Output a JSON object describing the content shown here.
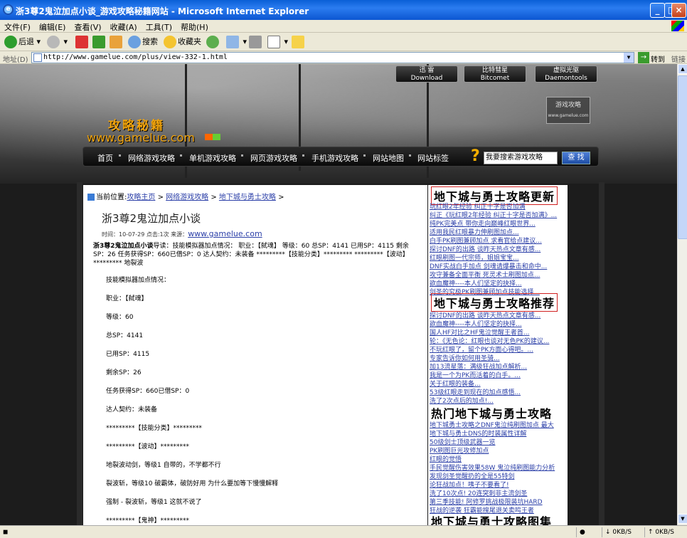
{
  "window": {
    "title": "浙3尊2鬼泣加点小谈_游戏攻略秘籍网站 - Microsoft Internet Explorer",
    "controls": {
      "minimize": "_",
      "maximize": "□",
      "close": "×"
    },
    "app_icon": "e"
  },
  "menu": [
    "文件(F)",
    "编辑(E)",
    "查看(V)",
    "收藏(A)",
    "工具(T)",
    "帮助(H)"
  ],
  "toolbar": {
    "back": "后退",
    "search": "搜索",
    "favorites": "收藏夹"
  },
  "address": {
    "label": "地址(D)",
    "url": "http://www.gamelue.com/plus/view-332-1.html",
    "dropdown": "▼",
    "go_arrow": "→",
    "go": "转到",
    "links": "链接"
  },
  "site": {
    "top_buttons": [
      {
        "label": "迅 雷",
        "sub": "Download"
      },
      {
        "label": "比特彗星",
        "sub": "Bitcomet"
      },
      {
        "label": "虚拟光驱",
        "sub": "Daemontools"
      }
    ],
    "stamp": {
      "line1": "游戏攻略",
      "line2": "www.gamelue.com"
    },
    "logo_text": "攻略秘籍",
    "logo_url": "www.gamelue.com",
    "nav": [
      "首页",
      "网络游戏攻略",
      "单机游戏攻略",
      "网页游戏攻略",
      "手机游戏攻略",
      "网站地图",
      "网站标签"
    ],
    "search_icon": "?",
    "search_placeholder": "我要搜索游戏攻略",
    "search_button": "查 找"
  },
  "article": {
    "breadcrumb_label": "当前位置:",
    "breadcrumb": [
      "攻略主页",
      "网络游戏攻略",
      "地下城与勇士攻略"
    ],
    "breadcrumb_sep": ">",
    "title": "浙3尊2鬼泣加点小谈",
    "meta_time": "时间：10-07-29 点击:1次 来源：",
    "meta_source": "www.gamelue.com",
    "summary_bold": "浙3尊2鬼泣加点小谈",
    "summary_text": "导读：技能模拟器加点情况： 职业：【弑魂】 等级：60 总SP：4141 已用SP：4115 剩余SP：26 任务获得SP：660已借SP：0 达人契约：未装备 *********【技能分类】********* *********【波动】********* 地裂波",
    "paragraphs": [
      "技能模拟器加点情况：",
      "职业：【弑魂】",
      "等级：60",
      "总SP：4141",
      "已用SP：4115",
      "剩余SP：26",
      "任务获得SP：660已借SP：0",
      "达人契约：未装备",
      "*********【技能分类】*********",
      "*********【波动】*********",
      "地裂波动剑，等级1 自带的，不学都不行",
      "裂波斩，等级10 破霸体，破防好用 为什么要加等下慢慢解释",
      "强制 - 裂波斩，等级1 这就不说了",
      "*********【鬼神】*********"
    ]
  },
  "sidebar": {
    "sections": [
      {
        "heading": "地下城与勇士攻略更新",
        "links": [
          "玩红眼2年经验 纠正十字是否加满",
          "纠正《玩红眼2年经验 纠正十字是否加满》...",
          "纯PK完美点 带你走向巅峰红眼世界...",
          "适用我民红眼暴力伸刷图加点...",
          "白手PK刷图兼顾加点 求看官给点建议...",
          "探讨DNF的出路 谈昨天热点文章有感...",
          "红眼刷图一代宗师，姐姐宝宝...",
          "DNF实战白手加点 剑魂请爆暴击和命中...",
          "攻守兼备全面平衡 死灵术士刷图加点...",
          "欲血魔神----本人们坚定的抉择...",
          "剑圣的究极PK刷图兼顾加点技能选择..."
        ]
      },
      {
        "heading": "地下城与勇士攻略推荐",
        "links": [
          "探讨DNF的出路 谈昨天热点文章有感...",
          "欲血魔神----本人们坚定的抉择...",
          "国人HF对比之HF鬼泣觉醒王者首...",
          "轮：《无色论：红眼也谈对无色PK的建议...",
          "不玩红眼了，留个PK方面心得吧。...",
          "专家告诉你如何用圣骑...",
          "加13流星落：满级狂战加点解析...",
          "我是一个为PK而活着的白手。...",
          "关于红眼的装备...",
          "53级红眼走到现在的加点感悟...",
          "洗了2次点后的加点!..."
        ]
      },
      {
        "heading": "热门地下城与勇士攻略",
        "links": [
          "地下城勇士攻略之DNF鬼泣纯刷图加点 最大",
          "地下城与勇士DNS的时装属性详解",
          "50级剑士顶级武器一览",
          "PK刷图巨光攻修加点",
          "红眼的觉悟",
          "手民觉醒伤害效果58W 鬼泣纯刷图能力分析",
          "发现剑圣觉醒扔的全是55特剑",
          "论狂战加点！咦子不要看了!",
          "洗了10次点! 20连突刺非主流剑圣",
          "第三季技能! 阿修罗挑战极限装坑HARD",
          "狂战的逆袭 狂霸能搜尾退关卖鸣王者"
        ]
      },
      {
        "heading": "地下城与勇士攻略图集",
        "links": []
      }
    ]
  },
  "status": {
    "speed_down": "0KB/S",
    "speed_up": "0KB/S"
  }
}
